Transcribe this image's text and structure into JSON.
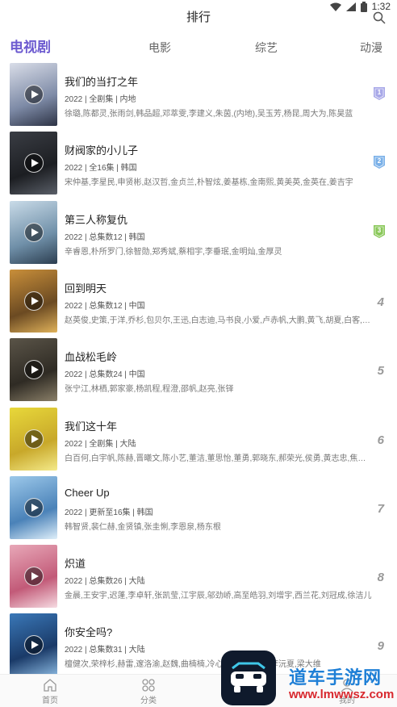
{
  "status": {
    "time": "1:32"
  },
  "header": {
    "title": "排行"
  },
  "tabs": [
    {
      "label": "电视剧",
      "active": true
    },
    {
      "label": "电影",
      "active": false
    },
    {
      "label": "综艺",
      "active": false
    },
    {
      "label": "动漫",
      "active": false
    }
  ],
  "items": [
    {
      "rank": "1",
      "title": "我们的当打之年",
      "meta": "2022 | 全剧集 | 内地",
      "cast": "徐璐,陈都灵,张雨剑,韩品超,邓萃雯,李建义,朱茵,(内地),吴玉芳,杨昆,周大为,陈昊蓝",
      "poster_colors": [
        "#d9dde8",
        "#7d8aa6",
        "#2d3345"
      ]
    },
    {
      "rank": "2",
      "title": "财阀家的小儿子",
      "meta": "2022 | 全16集 | 韩国",
      "cast": "宋仲基,李星民,申贤彬,赵汉哲,金贞兰,朴智炫,姜基栋,金南熙,黄美英,金英在,姜吉宇",
      "poster_colors": [
        "#3a3d44",
        "#1c1e22",
        "#5a5f68"
      ]
    },
    {
      "rank": "3",
      "title": "第三人称复仇",
      "meta": "2022 | 总集数12 | 韩国",
      "cast": "辛睿恩,朴所罗门,徐智勋,郑秀斌,蔡相宇,李垂珉,金明灿,金厚灵",
      "poster_colors": [
        "#c9dbe8",
        "#6f8fa8",
        "#2c3e50"
      ]
    },
    {
      "rank": "4",
      "title": "回到明天",
      "meta": "2022 | 总集数12 | 中国",
      "cast": "赵英俊,史策,于洋,乔杉,包贝尔,王迅,白志迪,马书良,小爱,卢赤帆,大鹏,黄飞,胡夏,白客,崔志佳",
      "poster_colors": [
        "#c98f3a",
        "#6b4a22",
        "#e0b25a"
      ]
    },
    {
      "rank": "5",
      "title": "血战松毛岭",
      "meta": "2022 | 总集数24 | 中国",
      "cast": "张宁江,林栖,郭家豪,杨凯程,程澄,邵帆,赵亮,张铎",
      "poster_colors": [
        "#5a5448",
        "#2f2b24",
        "#8a7f68"
      ]
    },
    {
      "rank": "6",
      "title": "我们这十年",
      "meta": "2022 | 全剧集 | 大陆",
      "cast": "白百何,白宇帆,陈赫,晋曦文,陈小艺,董洁,董思怡,董勇,郭晓东,郝荣光,侯勇,黄志忠,焦俊艳,金世佳",
      "poster_colors": [
        "#e8d83a",
        "#c8a82a",
        "#f4ea8a"
      ]
    },
    {
      "rank": "7",
      "title": "Cheer Up",
      "meta": "2022 | 更新至16集 | 韩国",
      "cast": "韩智贤,裴仁赫,金贤镇,张圭悧,李恩泉,杨东根",
      "poster_colors": [
        "#9cc8ea",
        "#4a82b8",
        "#dfeffa"
      ]
    },
    {
      "rank": "8",
      "title": "炽道",
      "meta": "2022 | 总集数26 | 大陆",
      "cast": "金晨,王安宇,迟蓬,李卓轩,张凯莹,江宇辰,邬劲峤,高至皓羽,刘增宇,西兰花,刘冠成,徐洁儿",
      "poster_colors": [
        "#e8a8b8",
        "#c25a78",
        "#f6dbe2"
      ]
    },
    {
      "rank": "9",
      "title": "你安全吗?",
      "meta": "2022 | 总集数31 | 大陆",
      "cast": "檀健次,荣梓杉,赫雷,邃洛渝,赵魏,曲楠楠,冷心,高叶,陈亭妃,李沅夏,梁大维",
      "poster_colors": [
        "#3a78b8",
        "#1a3a68",
        "#8ab8e0"
      ]
    }
  ],
  "bottom_nav": [
    {
      "label": "首页",
      "icon": "home-icon"
    },
    {
      "label": "分类",
      "icon": "grid-icon"
    },
    {
      "label": "我的",
      "icon": "user-icon"
    }
  ],
  "watermark": {
    "name": "道车手游网",
    "url": "www.lmwwsz.com"
  },
  "colors": {
    "accent": "#6d5bd0",
    "badge_1": "#a8a8e8",
    "badge_2": "#7ab0e8",
    "badge_3": "#8ac85a",
    "watermark_blue": "#1e7fd6",
    "watermark_red": "#d8282e"
  }
}
